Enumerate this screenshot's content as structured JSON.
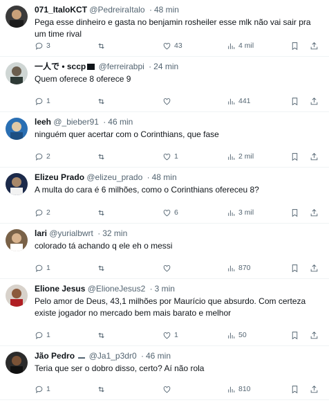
{
  "colors": {
    "text": "#0f1419",
    "muted": "#536471",
    "divider": "#eff3f4"
  },
  "icons": [
    "reply-icon",
    "retweet-icon",
    "like-icon",
    "views-icon",
    "bookmark-icon",
    "share-icon"
  ],
  "tweets": [
    {
      "name": "071_ItaloKCT",
      "handle": "@PedreiraItalo",
      "sep": "·",
      "time": "48 min",
      "text": "Pega esse dinheiro e gasta no benjamin rosheiler esse mlk não vai sair pra um time rival",
      "replies": "3",
      "retweets": "",
      "likes": "43",
      "views": "4 mil"
    },
    {
      "name": "一人で • sccp",
      "handle": "@ferreirabpi",
      "sep": "·",
      "time": "24 min",
      "text": "Quem oferece 8 oferece 9",
      "replies": "1",
      "retweets": "",
      "likes": "",
      "views": "441"
    },
    {
      "name": "leeh",
      "handle": "@_bieber91",
      "sep": "·",
      "time": "46 min",
      "text": "ninguém quer acertar com o Corinthians, que fase",
      "replies": "2",
      "retweets": "",
      "likes": "1",
      "views": "2 mil"
    },
    {
      "name": "Elizeu Prado",
      "handle": "@elizeu_prado",
      "sep": "·",
      "time": "48 min",
      "text": "A multa do cara é 6 milhões, como o Corinthians ofereceu 8?",
      "replies": "2",
      "retweets": "",
      "likes": "6",
      "views": "3 mil"
    },
    {
      "name": "lari",
      "handle": "@yurialbwrt",
      "sep": "·",
      "time": "32 min",
      "text": "colorado tá achando q ele eh o messi",
      "replies": "1",
      "retweets": "",
      "likes": "",
      "views": "870"
    },
    {
      "name": "Elione Jesus",
      "handle": "@ElioneJesus2",
      "sep": "·",
      "time": "3 min",
      "text": "Pelo amor de Deus, 43,1 milhões por Maurício que absurdo. Com certeza existe  jogador no mercado bem mais barato e melhor",
      "replies": "1",
      "retweets": "",
      "likes": "1",
      "views": "50"
    },
    {
      "name": "Jão Pedro",
      "handle": "@Ja1_p3dr0",
      "sep": "·",
      "time": "46 min",
      "text": "Teria que ser o dobro disso, certo? Aí não rola",
      "replies": "1",
      "retweets": "",
      "likes": "",
      "views": "810"
    }
  ]
}
